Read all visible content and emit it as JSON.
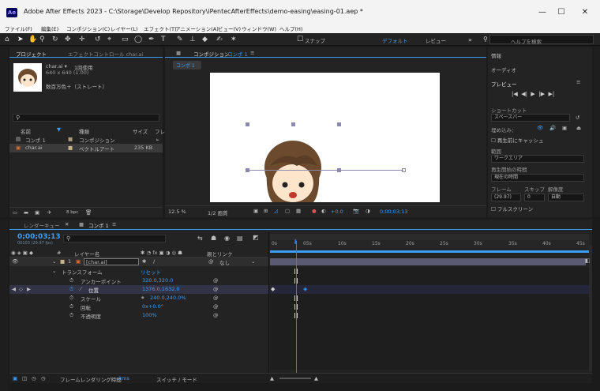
{
  "window": {
    "title": "Adobe After Effects 2023 - C:\\Storage\\Develop Repository\\iPentecAfterEffects\\demo-easing\\easing-01.aep *",
    "icon_label": "Ae"
  },
  "menu": [
    "ファイル(F)",
    "編集(E)",
    "コンポジション(C)",
    "レイヤー(L)",
    "エフェクト(T)",
    "アニメーション(A)",
    "ビュー(V)",
    "ウィンドウ(W)",
    "ヘルプ(H)"
  ],
  "toolbar": {
    "snap_label": "スナップ",
    "workspace_default": "デフォルト",
    "workspace_review": "レビュー",
    "search_placeholder": "ヘルプを検索"
  },
  "project": {
    "tab": "プロジェクト",
    "effects_tab": "エフェクトコントロール char.ai",
    "item_name": "char.ai ▾",
    "used": "1回使用",
    "size": "640 x 640 (1.00)",
    "color": "数百万色＋（ストレート）",
    "col_name": "名前",
    "col_type": "種類",
    "col_size": "サイズ",
    "col_f": "フレ",
    "search_placeholder": "",
    "bpc": "8 bpc",
    "rows": [
      {
        "name": "コンポ 1",
        "type": "コンポジション",
        "size": ""
      },
      {
        "name": "char.ai",
        "type": "ベクトルアート",
        "size": "235 KB"
      }
    ]
  },
  "comp_viewer": {
    "tab": "コンポジション",
    "tab_name": "コンポ 1",
    "sub_tab": "コンポ 1",
    "zoom": "12.5 %",
    "resolution": "1/2 画質",
    "exposure": "+0.0",
    "timecode": "0;00;03;13"
  },
  "right_panel": {
    "info": "情報",
    "audio": "オーディオ",
    "preview": "プレビュー",
    "shortcut_label": "ショートカット",
    "shortcut_value": "スペースバー",
    "include": "埋め込み：",
    "cache_before": "再生前にキャッシュ",
    "range_label": "範囲",
    "range_value": "ワークエリア",
    "start_label": "再生開始の時間",
    "start_value": "現在の時間",
    "frame_label": "フレーム",
    "skip_label": "スキップ",
    "res_label": "解像度",
    "frame_value": "(29.97)",
    "skip_value": "0",
    "res_value": "自動",
    "fullscreen": "フルスクリーン"
  },
  "timeline": {
    "render_tab": "レンダーキュー",
    "comp_tab": "コンポ 1",
    "timecode": "0;00;03;13",
    "fps": "00103 (29.97 fps)",
    "search_placeholder": "",
    "col_num": "#",
    "col_layer": "レイヤー名",
    "col_parent": "親とリンク",
    "layer_num": "1",
    "layer_name": "[char.ai]",
    "parent_value": "なし",
    "transform": "トランスフォーム",
    "reset": "リセット",
    "props": [
      {
        "name": "アンカーポイント",
        "value": "320.0,320.0"
      },
      {
        "name": "位置",
        "value": "1376.0,1632.0"
      },
      {
        "name": "スケール",
        "value": "240.0,240.0%"
      },
      {
        "name": "回転",
        "value": "0x+0.0°"
      },
      {
        "name": "不透明度",
        "value": "100%"
      }
    ],
    "ruler": [
      "0s",
      "05s",
      "10s",
      "15s",
      "20s",
      "25s",
      "30s",
      "35s",
      "40s",
      "45s"
    ],
    "render_time_label": "フレームレンダリング時間",
    "render_time": "1ms",
    "switch_mode": "スイッチ / モード"
  },
  "colors": {
    "accent": "#3d9df5",
    "panel": "#232323",
    "titlebar": "#f3f3f3",
    "playhead": "#2f7fe0",
    "layer_bar": "#5a5a72"
  }
}
